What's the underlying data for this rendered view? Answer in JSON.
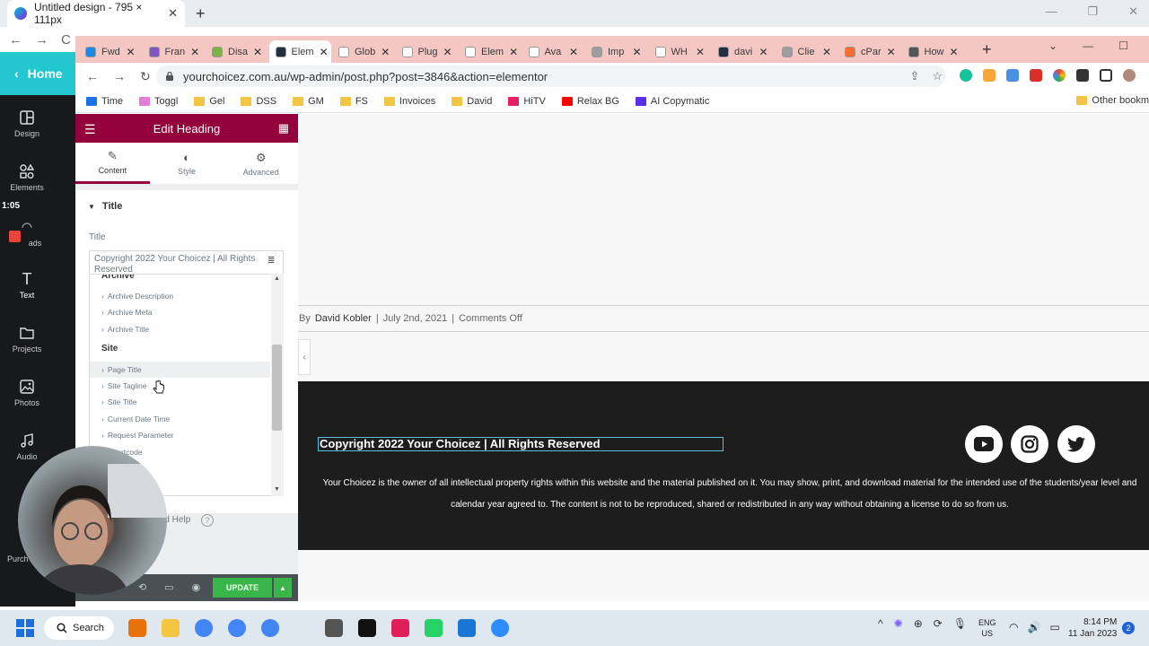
{
  "outer_browser": {
    "tab_title": "Untitled design - 795 × 111px",
    "close": "✕",
    "new_tab": "+",
    "nav": {
      "back": "←",
      "forward": "→",
      "reload": "C"
    },
    "window_controls": {
      "minimize": "—",
      "restore": "❐",
      "close": "✕"
    }
  },
  "canva": {
    "home_label": "Home",
    "home_arrow": "‹",
    "sidebar": [
      {
        "label": "Design",
        "icon": "design-icon"
      },
      {
        "label": "Elements",
        "icon": "elements-icon"
      },
      {
        "label": "ads",
        "icon": "uploads-icon"
      },
      {
        "label": "Text",
        "icon": "text-icon"
      },
      {
        "label": "Projects",
        "icon": "folder-icon"
      },
      {
        "label": "Photos",
        "icon": "photo-icon"
      },
      {
        "label": "Audio",
        "icon": "music-icon"
      },
      {
        "label": "Purch",
        "icon": "cart-icon"
      }
    ],
    "timer": "1:05"
  },
  "inner_browser": {
    "tabs": [
      {
        "label": "Fwd",
        "color": "#1e88e5"
      },
      {
        "label": "Fran",
        "color": "#7e57c2"
      },
      {
        "label": "Disa",
        "color": "#7cb342"
      },
      {
        "label": "Elem",
        "color": "#222f3e",
        "active": true
      },
      {
        "label": "Glob",
        "color": "#ffffff"
      },
      {
        "label": "Plug",
        "color": "#ffffff"
      },
      {
        "label": "Elem",
        "color": "#ffffff"
      },
      {
        "label": "Ava",
        "color": "#ffffff"
      },
      {
        "label": "Imp",
        "color": "#9e9e9e"
      },
      {
        "label": "WH",
        "color": "#ffffff"
      },
      {
        "label": "davi",
        "color": "#222f3e"
      },
      {
        "label": "Clie",
        "color": "#9e9e9e"
      },
      {
        "label": "cPar",
        "color": "#ff6c2c"
      },
      {
        "label": "How",
        "color": "#555555"
      }
    ],
    "url": "yourchoicez.com.au/wp-admin/post.php?post=3846&action=elementor",
    "bookmarks": [
      {
        "label": "Time",
        "color": "#1a73e8"
      },
      {
        "label": "Toggl",
        "color": "#e57cd8"
      },
      {
        "label": "Gel",
        "color": "#f4c542"
      },
      {
        "label": "DSS",
        "color": "#f4c542"
      },
      {
        "label": "GM",
        "color": "#f4c542"
      },
      {
        "label": "FS",
        "color": "#f4c542"
      },
      {
        "label": "Invoices",
        "color": "#f4c542"
      },
      {
        "label": "David",
        "color": "#f4c542"
      },
      {
        "label": "HiTV",
        "color": "#e91e63"
      },
      {
        "label": "Relax BG",
        "color": "#ff0000"
      },
      {
        "label": "AI Copymatic",
        "color": "#5b2ee8"
      }
    ],
    "other_bookmarks": "Other bookm"
  },
  "elementor": {
    "panel_title": "Edit Heading",
    "tabs": [
      {
        "label": "Content",
        "icon": "pencil-icon"
      },
      {
        "label": "Style",
        "icon": "half-circle-icon"
      },
      {
        "label": "Advanced",
        "icon": "gear-icon"
      }
    ],
    "section_title": "Title",
    "field_label": "Title",
    "title_value": "Copyright 2022 Your Choicez | All Rights Reserved",
    "dropdown": {
      "partial_group": "Archive",
      "archive_items": [
        "Archive Description",
        "Archive Meta",
        "Archive Title"
      ],
      "site_group": "Site",
      "site_items": [
        "Page Title",
        "Site Tagline",
        "Site Title",
        "Current Date Time",
        "Request Parameter",
        "Shortcode"
      ],
      "highlighted": "Page Title"
    },
    "help_text": "Need Help",
    "update_label": "UPDATE"
  },
  "preview": {
    "meta_prefix": "By",
    "author": "David Kobler",
    "separator": "|",
    "date": "July 2nd, 2021",
    "comments": "Comments Off",
    "copyright": "Copyright 2022 Your Choicez | All Rights Reserved",
    "legal": "Your Choicez is the owner of all intellectual property rights within this website and the material published on it. You may show, print, and download material for the intended use of the students/year level and calendar year agreed to. The content is not to be reproduced, shared or redistributed in any way without obtaining a license to do so from us.",
    "social": [
      "youtube-icon",
      "instagram-icon",
      "twitter-icon"
    ]
  },
  "taskbar": {
    "search_label": "Search",
    "lang_line1": "ENG",
    "lang_line2": "US",
    "time": "8:14 PM",
    "date": "11 Jan 2023",
    "notification_count": "2",
    "app_colors": [
      "#e8710a",
      "#f4c542",
      "#4285f4",
      "#4285f4",
      "#4285f4",
      "#555555",
      "#111111",
      "#e01e5a",
      "#25d366",
      "#1976d2",
      "#2d8cff"
    ]
  },
  "colors": {
    "elementor_brand": "#93003c",
    "update_green": "#39b54a",
    "canva_teal": "#22c7cf",
    "tab_strip": "#f4c7c3"
  }
}
